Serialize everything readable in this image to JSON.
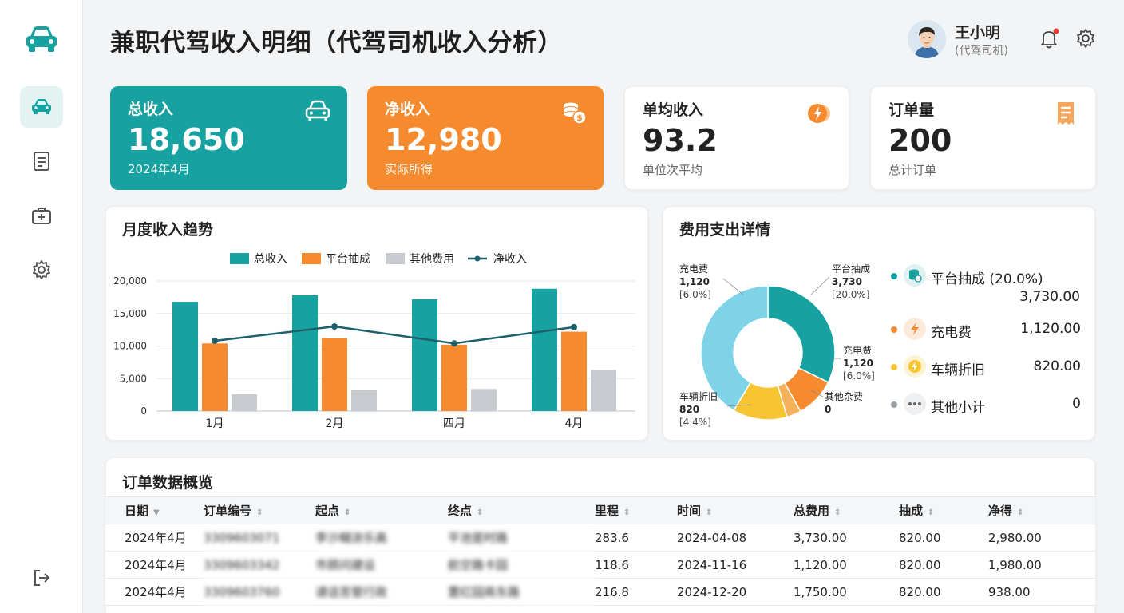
{
  "header": {
    "title": "兼职代驾收入明细（代驾司机收入分析）",
    "user_name": "王小明",
    "user_role": "(代驾司机)"
  },
  "sidebar": {
    "items": [
      {
        "icon": "car-icon",
        "active": true
      },
      {
        "icon": "document-icon",
        "active": false
      },
      {
        "icon": "medical-kit-icon",
        "active": false
      },
      {
        "icon": "gear-icon",
        "active": false
      }
    ],
    "logout_icon": "logout-icon"
  },
  "stats": [
    {
      "title": "总收入",
      "value": "18,650",
      "sub": "2024年4月",
      "icon": "car-icon",
      "color": "#17a2a1"
    },
    {
      "title": "净收入",
      "value": "12,980",
      "sub": "实际所得",
      "icon": "coins-icon",
      "color": "#f58b2e"
    },
    {
      "title": "单均收入",
      "value": "93.2",
      "sub": "单位次平均",
      "icon": "lightning-coin-icon",
      "color": "#ffffff"
    },
    {
      "title": "订单量",
      "value": "200",
      "sub": "总计订单",
      "icon": "receipt-icon",
      "color": "#ffffff"
    }
  ],
  "trend": {
    "title": "月度收入趋势"
  },
  "expense": {
    "title": "费用支出详情",
    "donut_labels": [
      {
        "name": "充电费",
        "value": "1,120",
        "pct": "[6.0%]"
      },
      {
        "name": "平台抽成",
        "value": "3,730",
        "pct": "[20.0%]"
      },
      {
        "name": "充电费",
        "value": "1,120",
        "pct": "[6.0%]"
      },
      {
        "name": "其他杂费",
        "value": "0",
        "pct": ""
      },
      {
        "name": "车辆折旧",
        "value": "820",
        "pct": "[4.4%]"
      }
    ],
    "list": [
      {
        "label": "平台抽成 (20.0%)",
        "value": "3,730.00",
        "dot": "#17a2a1",
        "icon": "database-coin-icon"
      },
      {
        "label": "充电费",
        "value": "1,120.00",
        "dot": "#f58b2e",
        "icon": "lightning-icon"
      },
      {
        "label": "车辆折旧",
        "value": "820.00",
        "dot": "#f7c531",
        "icon": "coin-lightning-icon"
      },
      {
        "label": "其他小计",
        "value": "0",
        "dot": "#9aa0a6",
        "icon": "more-dots-icon"
      }
    ]
  },
  "chart_data": [
    {
      "type": "bar",
      "title": "月度收入趋势",
      "categories": [
        "1月",
        "2月",
        "四月",
        "4月"
      ],
      "series": [
        {
          "name": "总收入",
          "kind": "bar",
          "color": "#17a2a1",
          "values": [
            16800,
            17800,
            17200,
            18800
          ]
        },
        {
          "name": "平台抽成",
          "kind": "bar",
          "color": "#f58b2e",
          "values": [
            10400,
            11200,
            10200,
            12200
          ]
        },
        {
          "name": "其他费用",
          "kind": "bar",
          "color": "#c8ccd1",
          "values": [
            2600,
            3200,
            3400,
            6300
          ]
        },
        {
          "name": "净收入",
          "kind": "line",
          "color": "#1d5f6b",
          "values": [
            10800,
            13000,
            10400,
            12900
          ]
        }
      ],
      "y_ticks": [
        "0",
        "5,000",
        "10,000",
        "15,000",
        "20,000"
      ],
      "ylim": [
        0,
        20000
      ],
      "grid": true,
      "legend": "top-center"
    },
    {
      "type": "pie",
      "title": "费用支出详情",
      "slices": [
        {
          "name": "平台抽成",
          "value": 3730,
          "color": "#17a2a1"
        },
        {
          "name": "充电费",
          "value": 1120,
          "color": "#f58b2e"
        },
        {
          "name": "其他杂费",
          "value": 400,
          "color": "#f6b15a"
        },
        {
          "name": "车辆折旧",
          "value": 1520,
          "color": "#f7c531"
        },
        {
          "name": "其他",
          "value": 4800,
          "color": "#7fd3e8"
        }
      ],
      "donut": true
    }
  ],
  "orders": {
    "title": "订单数据概览",
    "columns": [
      "日期",
      "订单编号",
      "起点",
      "终点",
      "里程",
      "时间",
      "总费用",
      "抽成",
      "净得"
    ],
    "rows": [
      [
        "2024年4月",
        "3309603071",
        "李沙糊涂乐高",
        "平池是时路",
        "283.6",
        "2024-04-08",
        "3,730.00",
        "820.00",
        "2,980.00"
      ],
      [
        "2024年4月",
        "3309603342",
        "市顾问建设",
        "航空路卡园",
        "118.6",
        "2024-11-16",
        "1,120.00",
        "820.00",
        "1,980.00"
      ],
      [
        "2024年4月",
        "3309603760",
        "请话苦管行政",
        "置红园商东路",
        "216.8",
        "2024-12-20",
        "1,750.00",
        "820.00",
        "938.00"
      ]
    ]
  }
}
